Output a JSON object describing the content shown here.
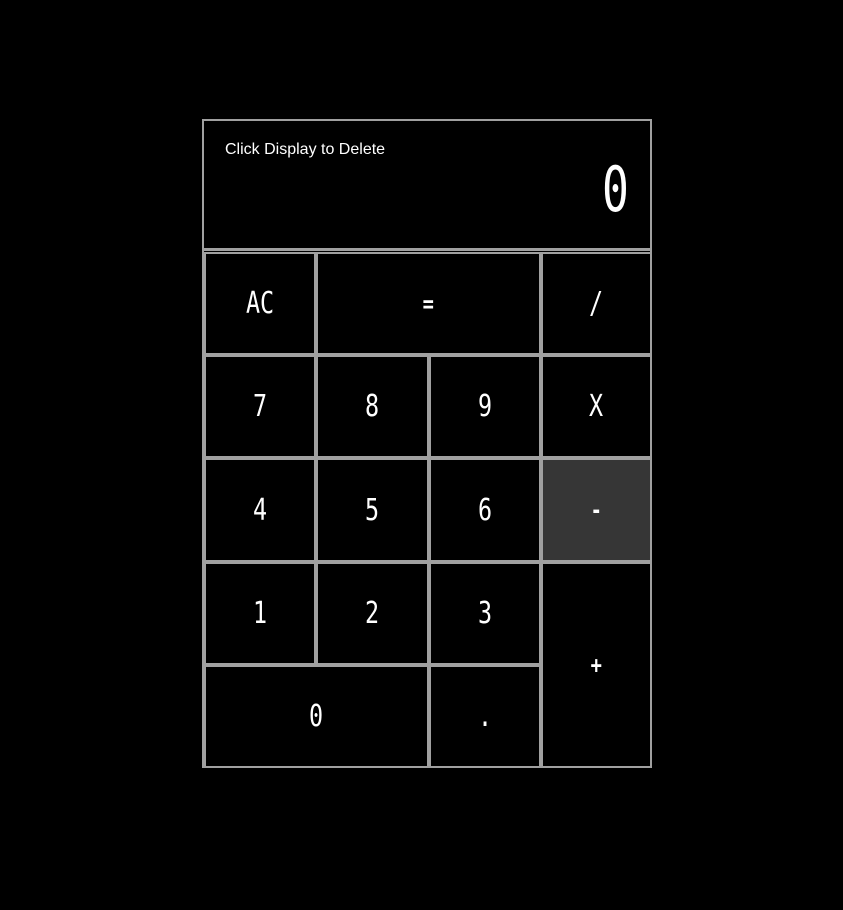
{
  "display": {
    "hint": "Click Display to Delete",
    "value": "0"
  },
  "keys": {
    "clear": "AC",
    "equals": "=",
    "divide": "/",
    "seven": "7",
    "eight": "8",
    "nine": "9",
    "multiply": "X",
    "four": "4",
    "five": "5",
    "six": "6",
    "subtract": "-",
    "one": "1",
    "two": "2",
    "three": "3",
    "add": "+",
    "zero": "0",
    "decimal": "."
  },
  "colors": {
    "background": "#000000",
    "border": "#a0a0a0",
    "highlighted_key": "#363636",
    "text": "#ffffff"
  }
}
